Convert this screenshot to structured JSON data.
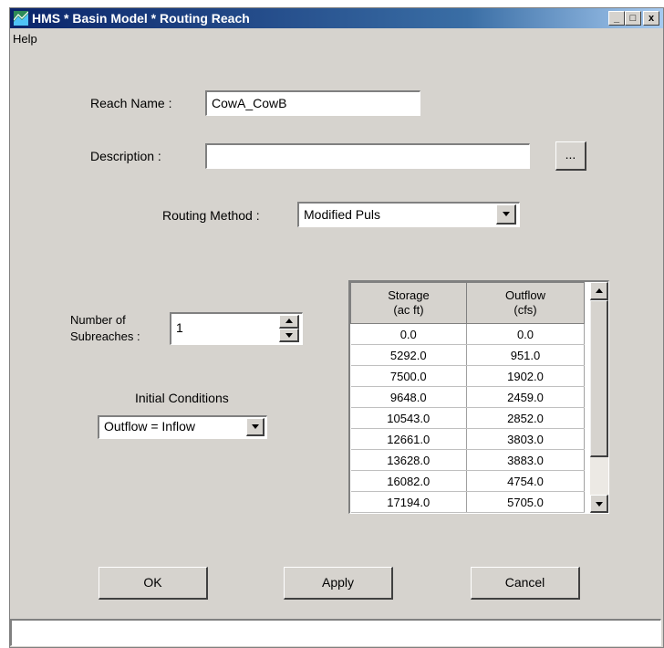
{
  "window": {
    "title": "HMS * Basin Model * Routing Reach",
    "controls": {
      "minimize": "_",
      "maximize": "□",
      "close": "x"
    }
  },
  "menu": {
    "help": "Help"
  },
  "form": {
    "reach_name_label": "Reach Name :",
    "reach_name_value": "CowA_CowB",
    "description_label": "Description :",
    "description_value": "",
    "description_browse": "...",
    "routing_method_label": "Routing Method :",
    "routing_method_value": "Modified Puls",
    "subreaches_label_line1": "Number of",
    "subreaches_label_line2": "Subreaches :",
    "subreaches_value": "1",
    "initial_conditions_label": "Initial Conditions",
    "initial_conditions_value": "Outflow = Inflow"
  },
  "table": {
    "columns": [
      {
        "line1": "Storage",
        "line2": "(ac ft)"
      },
      {
        "line1": "Outflow",
        "line2": "(cfs)"
      }
    ],
    "rows": [
      [
        "0.0",
        "0.0"
      ],
      [
        "5292.0",
        "951.0"
      ],
      [
        "7500.0",
        "1902.0"
      ],
      [
        "9648.0",
        "2459.0"
      ],
      [
        "10543.0",
        "2852.0"
      ],
      [
        "12661.0",
        "3803.0"
      ],
      [
        "13628.0",
        "3883.0"
      ],
      [
        "16082.0",
        "4754.0"
      ],
      [
        "17194.0",
        "5705.0"
      ]
    ]
  },
  "buttons": {
    "ok": "OK",
    "apply": "Apply",
    "cancel": "Cancel"
  },
  "status": {
    "text": ""
  },
  "colors": {
    "window_bg": "#d6d3ce",
    "titlebar_start": "#0a246a",
    "titlebar_end": "#a6caf0"
  }
}
